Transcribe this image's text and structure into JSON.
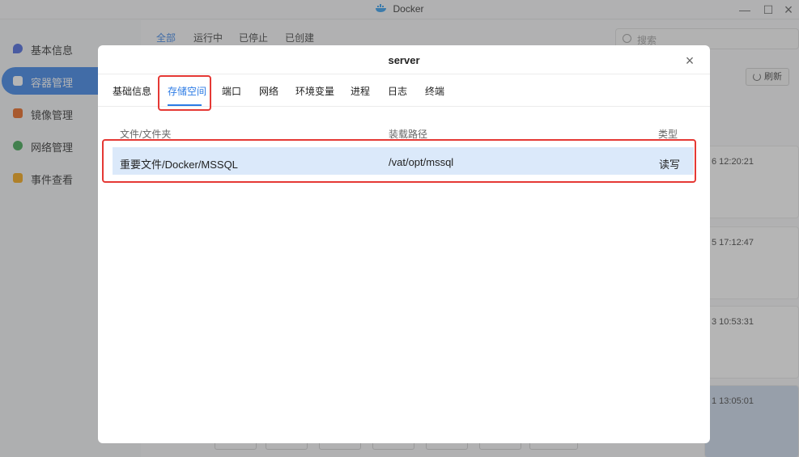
{
  "window": {
    "title": "Docker"
  },
  "sidebar": {
    "items": [
      {
        "label": "基本信息",
        "icon": "droplet-icon",
        "color": "#3b5bdb"
      },
      {
        "label": "容器管理",
        "icon": "cube-icon",
        "color": "#ffffff",
        "active": true
      },
      {
        "label": "镜像管理",
        "icon": "image-layer-icon",
        "color": "#e8590c"
      },
      {
        "label": "网络管理",
        "icon": "globe-icon",
        "color": "#2f9e44"
      },
      {
        "label": "事件查看",
        "icon": "calendar-icon",
        "color": "#f59f00"
      }
    ]
  },
  "background": {
    "filter_tabs": [
      "全部",
      "运行中",
      "已停止",
      "已创建"
    ],
    "search_placeholder": "搜索",
    "refresh_label": "刷新",
    "timestamps": [
      "6 12:20:21",
      "5 17:12:47",
      "3 10:53:31",
      "1 13:05:01"
    ]
  },
  "modal": {
    "title": "server",
    "tabs": [
      "基础信息",
      "存储空间",
      "端口",
      "网络",
      "环境变量",
      "进程",
      "日志",
      "终端"
    ],
    "active_tab": "存储空间",
    "table": {
      "headers": [
        "文件/文件夹",
        "装载路径",
        "类型"
      ],
      "rows": [
        {
          "folder": "重要文件/Docker/MSSQL",
          "mount": "/vat/opt/mssql",
          "type": "读写"
        }
      ]
    }
  },
  "accent_color": "#2c7be5",
  "highlight_color": "#e53935"
}
